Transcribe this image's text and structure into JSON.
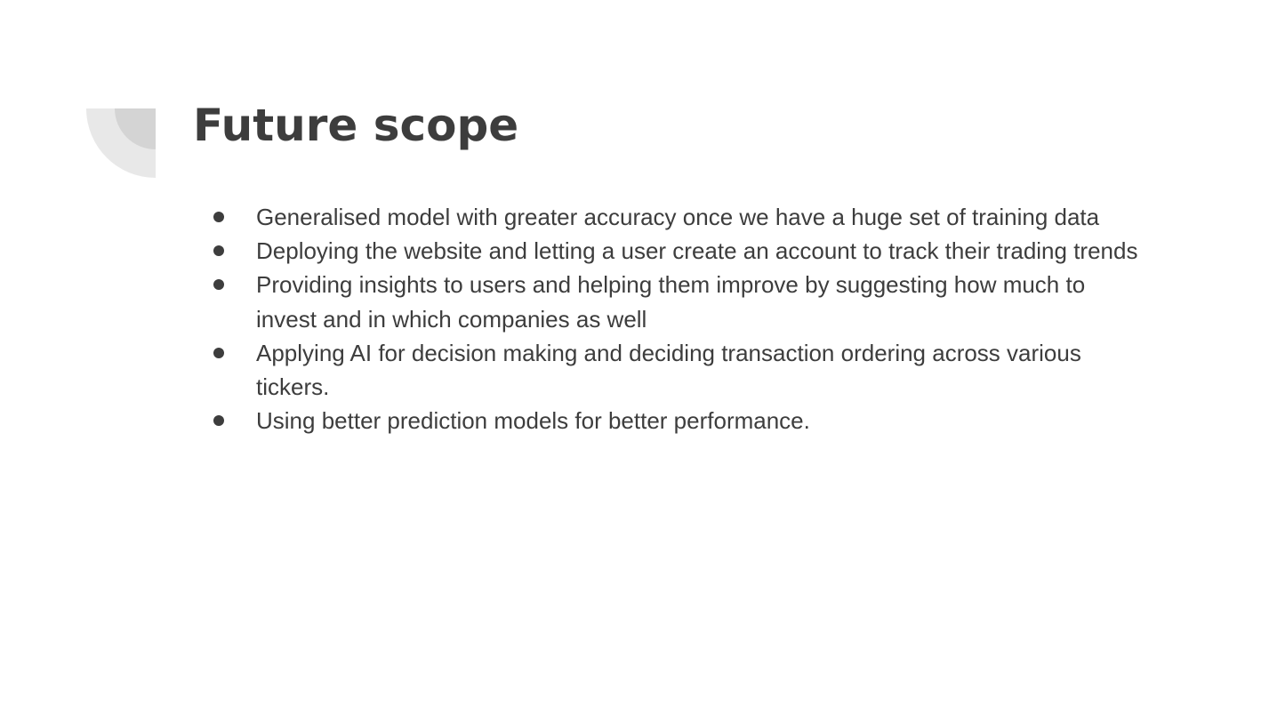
{
  "slide": {
    "title": "Future scope",
    "bullets": [
      "Generalised model with greater accuracy once we have a huge set of training data",
      "Deploying the website and letting a user create an account to track their trading trends",
      "Providing insights to users and helping them improve by suggesting how much to invest and in which companies as well",
      "Applying AI for decision making and deciding transaction ordering across various tickers.",
      "Using better prediction models for better performance."
    ]
  },
  "colors": {
    "text": "#3d3d3d",
    "ornament_outer": "#e8e8e8",
    "ornament_inner": "#d4d4d4",
    "background": "#ffffff"
  }
}
